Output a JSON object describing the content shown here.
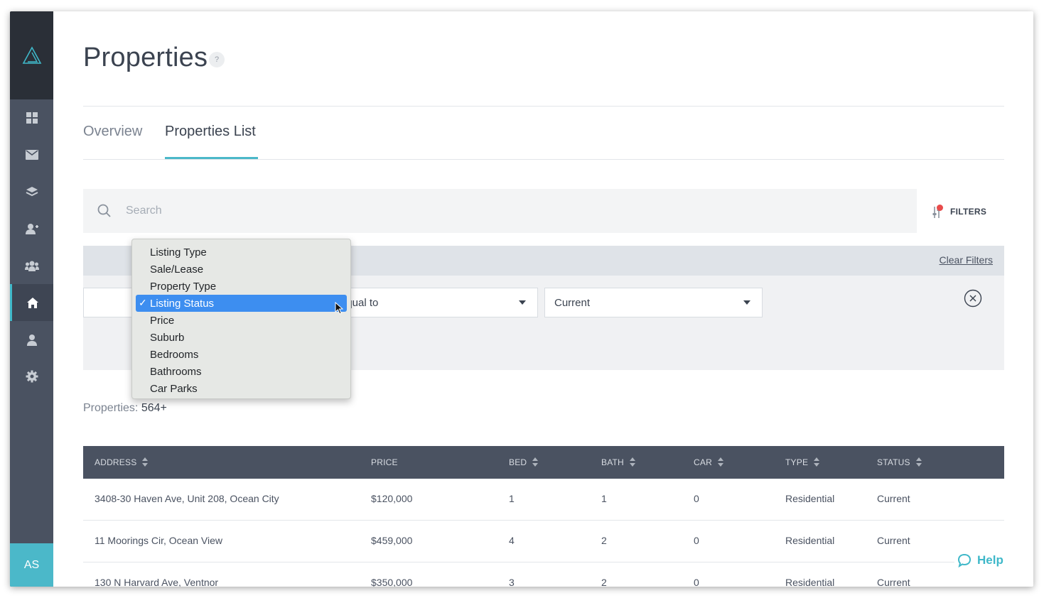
{
  "page": {
    "title": "Properties",
    "help_icon": "?"
  },
  "sidebar": {
    "items": [
      "dashboard-icon",
      "mail-icon",
      "layers-icon",
      "contacts-icon",
      "team-icon",
      "home-icon",
      "user-icon",
      "gear-icon"
    ],
    "active": "home-icon",
    "avatar_initials": "AS"
  },
  "tabs": [
    {
      "label": "Overview",
      "active": false
    },
    {
      "label": "Properties List",
      "active": true
    }
  ],
  "search": {
    "placeholder": "Search",
    "value": ""
  },
  "filters": {
    "button_label": "FILTERS",
    "clear_label": "Clear Filters",
    "operator": "is equal to",
    "value": "Current"
  },
  "dropdown": {
    "items": [
      "Listing Type",
      "Sale/Lease",
      "Property Type",
      "Listing Status",
      "Price",
      "Suburb",
      "Bedrooms",
      "Bathrooms",
      "Car Parks"
    ],
    "selected": "Listing Status",
    "check": "✓"
  },
  "summary": {
    "label": "Properties:",
    "count": "564+"
  },
  "table": {
    "columns": [
      "ADDRESS",
      "PRICE",
      "BED",
      "BATH",
      "CAR",
      "TYPE",
      "STATUS"
    ],
    "rows": [
      [
        "3408-30 Haven Ave, Unit 208, Ocean City",
        "$120,000",
        "1",
        "1",
        "0",
        "Residential",
        "Current"
      ],
      [
        "11 Moorings Cir, Ocean View",
        "$459,000",
        "4",
        "2",
        "0",
        "Residential",
        "Current"
      ],
      [
        "130 N Harvard Ave, Ventnor",
        "$350,000",
        "3",
        "2",
        "0",
        "Residential",
        "Current"
      ]
    ]
  },
  "help": {
    "label": "Help"
  },
  "colors": {
    "accent": "#4bb8c9",
    "sidebar": "#4a5261",
    "sidebar_dark": "#2a2f37",
    "table_header": "#4a5261",
    "selection": "#3d8ef0",
    "badge": "#e84b4b"
  }
}
